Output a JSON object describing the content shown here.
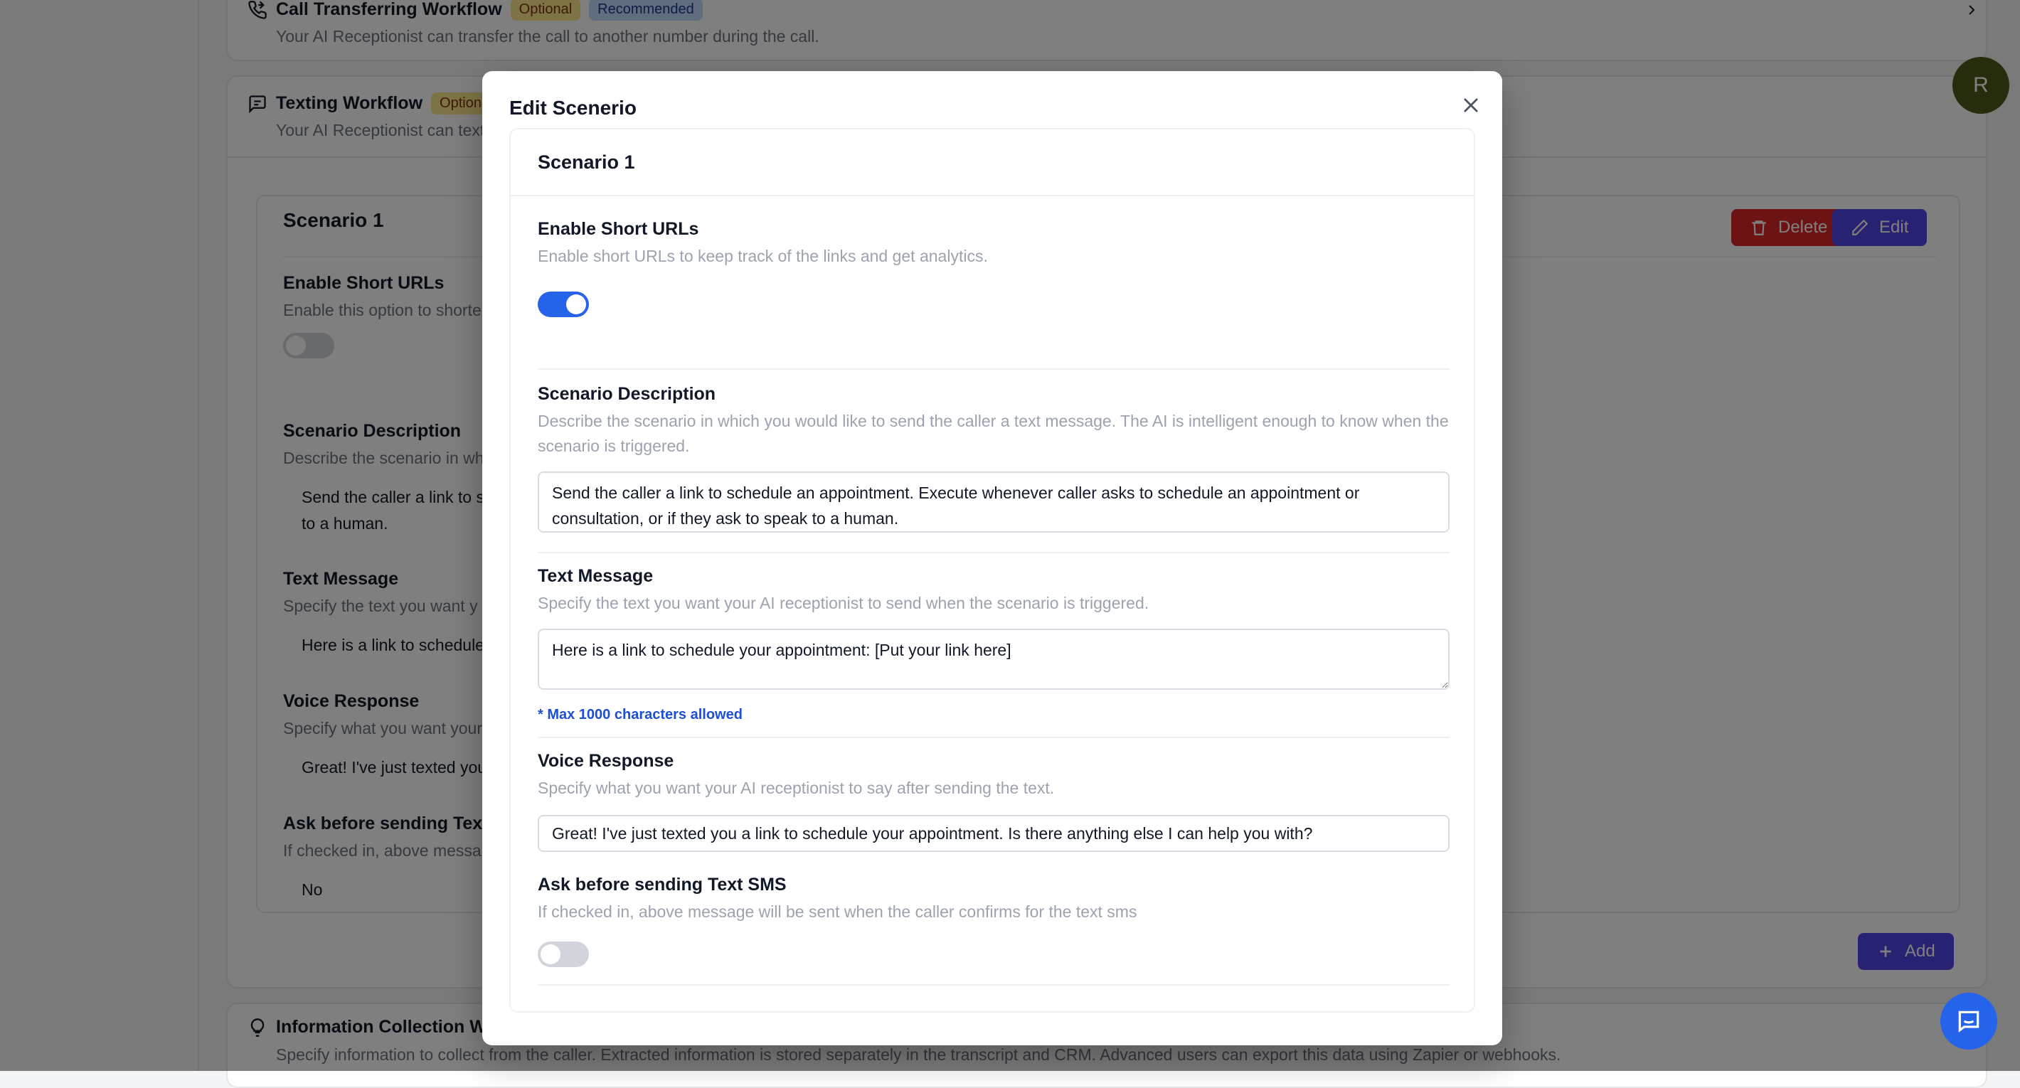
{
  "background": {
    "call_transfer": {
      "title": "Call Transferring Workflow",
      "badge_optional": "Optional",
      "badge_recommended": "Recommended",
      "subtitle": "Your AI Receptionist can transfer the call to another number during the call."
    },
    "texting": {
      "title": "Texting Workflow",
      "badge_optional": "Optional",
      "subtitle": "Your AI Receptionist can text"
    },
    "scenario_card": {
      "title": "Scenario 1",
      "delete_label": "Delete",
      "edit_label": "Edit",
      "short_urls_label": "Enable Short URLs",
      "short_urls_desc": "Enable this option to shorte",
      "desc_label": "Scenario Description",
      "desc_desc": "Describe the scenario in wh",
      "desc_value_line1": "Send the caller a link to s",
      "desc_value_line2": "to a human.",
      "text_label": "Text Message",
      "text_desc": "Specify the text you want y",
      "text_value": "Here is a link to schedule",
      "voice_label": "Voice Response",
      "voice_desc": "Specify what you want your",
      "voice_value": "Great! I've just texted you",
      "ask_label": "Ask before sending Text SM",
      "ask_desc": "If checked in, above messa",
      "ask_value": "No"
    },
    "add_label": "Add",
    "info_collection": {
      "title": "Information Collection Work",
      "subtitle": "Specify information to collect from the caller. Extracted information is stored separately in the transcript and CRM. Advanced users can export this data using Zapier or webhooks."
    },
    "avatar_initial": "R"
  },
  "modal": {
    "title": "Edit Scenerio",
    "scenario_title": "Scenario 1",
    "short_urls": {
      "label": "Enable Short URLs",
      "description": "Enable short URLs to keep track of the links and get analytics.",
      "enabled": true
    },
    "scenario_description": {
      "label": "Scenario Description",
      "description": "Describe the scenario in which you would like to send the caller a text message. The AI is intelligent enough to know when the scenario is triggered.",
      "value": "Send the caller a link to schedule an appointment. Execute whenever caller asks to schedule an appointment or consultation, or if they ask to speak to a human."
    },
    "text_message": {
      "label": "Text Message",
      "description": "Specify the text you want your AI receptionist to send when the scenario is triggered.",
      "value": "Here is a link to schedule your appointment: [Put your link here]",
      "hint": "* Max 1000 characters allowed"
    },
    "voice_response": {
      "label": "Voice Response",
      "description": "Specify what you want your AI receptionist to say after sending the text.",
      "value": "Great! I've just texted you a link to schedule your appointment. Is there anything else I can help you with?"
    },
    "ask_before_sending": {
      "label": "Ask before sending Text SMS",
      "description": "If checked in, above message will be sent when the caller confirms for the text sms",
      "enabled": false
    }
  },
  "colors": {
    "primary": "#2563eb",
    "indigo": "#4f46e5",
    "danger": "#dc2626",
    "hint": "#1d4ed8"
  },
  "icons": [
    "phone-forward-icon",
    "message-square-icon",
    "trash-icon",
    "pencil-icon",
    "plus-icon",
    "lightbulb-icon",
    "close-icon",
    "chevron-right-icon",
    "chat-icon"
  ]
}
